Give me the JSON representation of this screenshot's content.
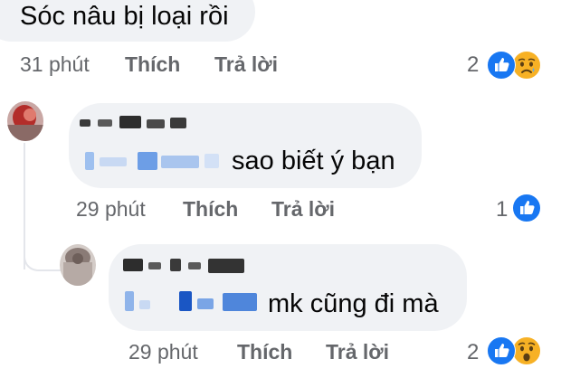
{
  "comments": [
    {
      "text": "Sóc nâu bị loại rồi",
      "time": "31 phút",
      "like_label": "Thích",
      "reply_label": "Trả lời",
      "reaction_count": "2",
      "reactions": [
        "like-icon",
        "sad-icon"
      ]
    },
    {
      "author_blurred": true,
      "text": "sao biết ý bạn",
      "time": "29 phút",
      "like_label": "Thích",
      "reply_label": "Trả lời",
      "reaction_count": "1",
      "reactions": [
        "like-icon"
      ]
    },
    {
      "author_blurred": true,
      "text": "mk cũng đi mà",
      "time": "29 phút",
      "like_label": "Thích",
      "reply_label": "Trả lời",
      "reaction_count": "2",
      "reactions": [
        "like-icon",
        "wow-icon"
      ]
    }
  ],
  "colors": {
    "bubble": "#f0f2f5",
    "meta_text": "#65676b",
    "like_blue": "#1877f2",
    "emoji_yellow": "#f7b125"
  }
}
